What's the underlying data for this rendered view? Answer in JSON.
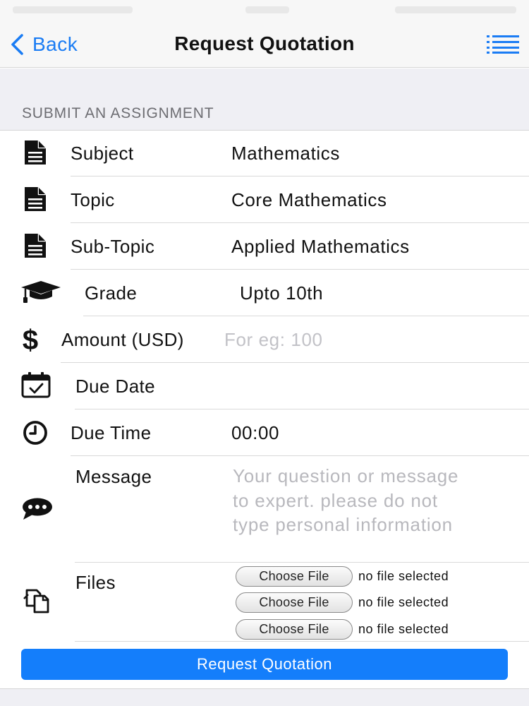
{
  "nav": {
    "back_label": "Back",
    "title": "Request Quotation"
  },
  "section_header": "SUBMIT AN ASSIGNMENT",
  "form": {
    "subject": {
      "label": "Subject",
      "value": "Mathematics",
      "icon": "document-icon"
    },
    "topic": {
      "label": "Topic",
      "value": "Core Mathematics",
      "icon": "document-icon"
    },
    "subtopic": {
      "label": "Sub-Topic",
      "value": "Applied Mathematics",
      "icon": "document-icon"
    },
    "grade": {
      "label": "Grade",
      "value": "Upto 10th",
      "icon": "graduation-cap-icon"
    },
    "amount": {
      "label": "Amount (USD)",
      "value": "",
      "placeholder": "For eg: 100",
      "icon": "dollar-icon"
    },
    "due_date": {
      "label": "Due Date",
      "value": "",
      "icon": "calendar-check-icon"
    },
    "due_time": {
      "label": "Due Time",
      "value": "00:00",
      "icon": "clock-icon"
    },
    "message": {
      "label": "Message",
      "value": "",
      "placeholder": "Your question or message to expert. please do not type personal information",
      "icon": "chat-bubble-icon"
    },
    "files": {
      "label": "Files",
      "icon": "copy-files-icon",
      "items": [
        {
          "button": "Choose File",
          "status": "no file selected"
        },
        {
          "button": "Choose File",
          "status": "no file selected"
        },
        {
          "button": "Choose File",
          "status": "no file selected"
        }
      ]
    }
  },
  "submit_label": "Request Quotation",
  "colors": {
    "accent": "#147efb",
    "nav_tint": "#1a7cf4",
    "group_background": "#efeff4",
    "placeholder": "#c2c2c7"
  }
}
